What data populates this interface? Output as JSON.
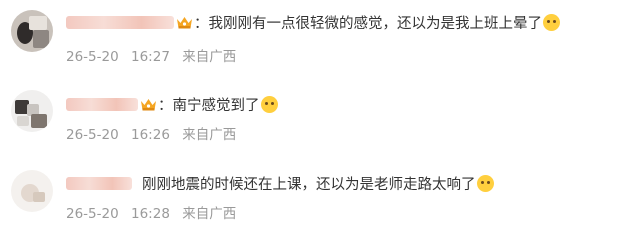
{
  "comments": [
    {
      "prefix": "：",
      "text": "我刚刚有一点很轻微的感觉，还以为是我上班上晕了",
      "emoji": "dizzy-face-emoji",
      "date": "26-5-20",
      "time": "16:27",
      "location": "来自广西",
      "has_crown": true
    },
    {
      "prefix": "：",
      "text": "南宁感觉到了",
      "emoji": "grimace-face-emoji",
      "date": "26-5-20",
      "time": "16:26",
      "location": "来自广西",
      "has_crown": true
    },
    {
      "prefix": "",
      "text": "刚刚地震的时候还在上课，还以为是老师走路太响了",
      "emoji": "fearful-face-emoji",
      "date": "26-5-20",
      "time": "16:28",
      "location": "来自广西",
      "has_crown": false
    }
  ],
  "colors": {
    "text": "#333333",
    "meta": "#9a9a9a",
    "crown": "#f5a623"
  }
}
